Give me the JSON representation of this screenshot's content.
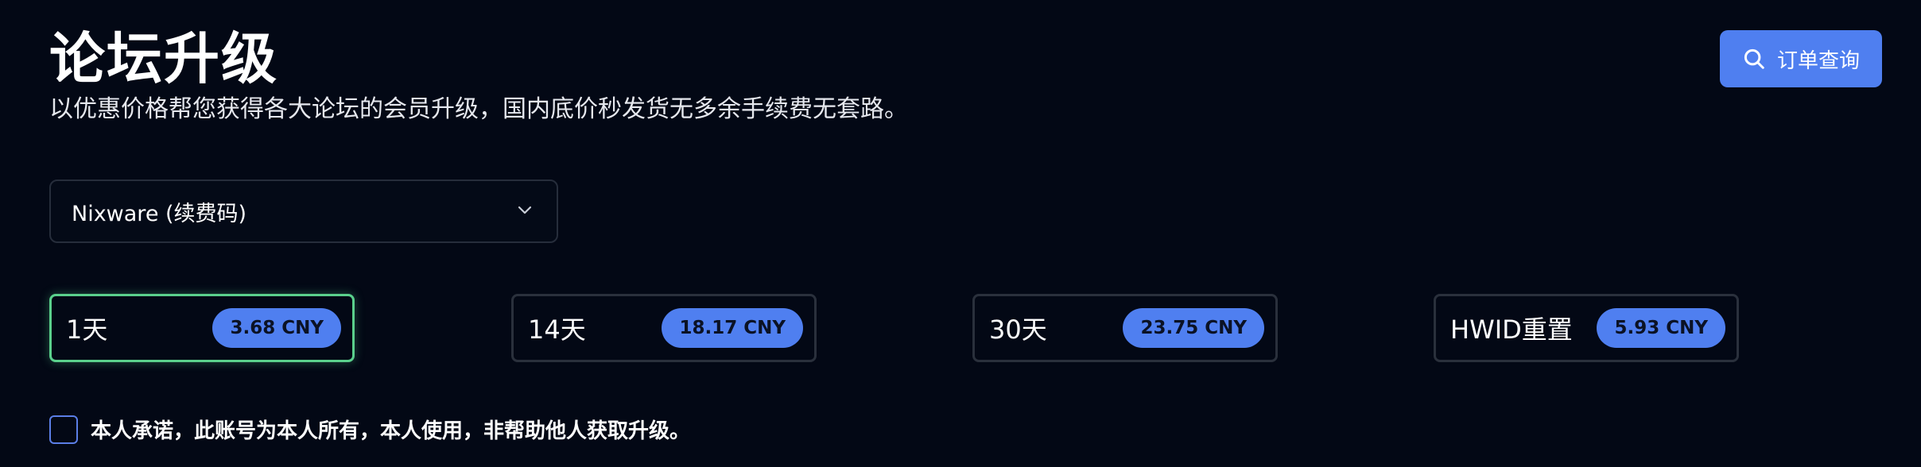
{
  "header": {
    "title": "论坛升级",
    "subtitle": "以优惠价格帮您获得各大论坛的会员升级，国内底价秒发货无多余手续费无套路。"
  },
  "actions": {
    "order_query_label": "订单查询",
    "order_query_icon": "search-icon"
  },
  "product_select": {
    "selected_value": "Nixware (续费码)",
    "icon": "chevron-down-icon"
  },
  "plans": [
    {
      "label": "1天",
      "price": "3.68 CNY",
      "selected": true
    },
    {
      "label": "14天",
      "price": "18.17 CNY",
      "selected": false
    },
    {
      "label": "30天",
      "price": "23.75 CNY",
      "selected": false
    },
    {
      "label": "HWID重置",
      "price": "5.93 CNY",
      "selected": false
    }
  ],
  "agreement": {
    "text": "本人承诺，此账号为本人所有，本人使用，非帮助他人获取升级。",
    "checked": false
  },
  "colors": {
    "background": "#030815",
    "accent": "#4f7ff0",
    "selected_border": "#5ad08c",
    "card_border": "#2a303c"
  }
}
